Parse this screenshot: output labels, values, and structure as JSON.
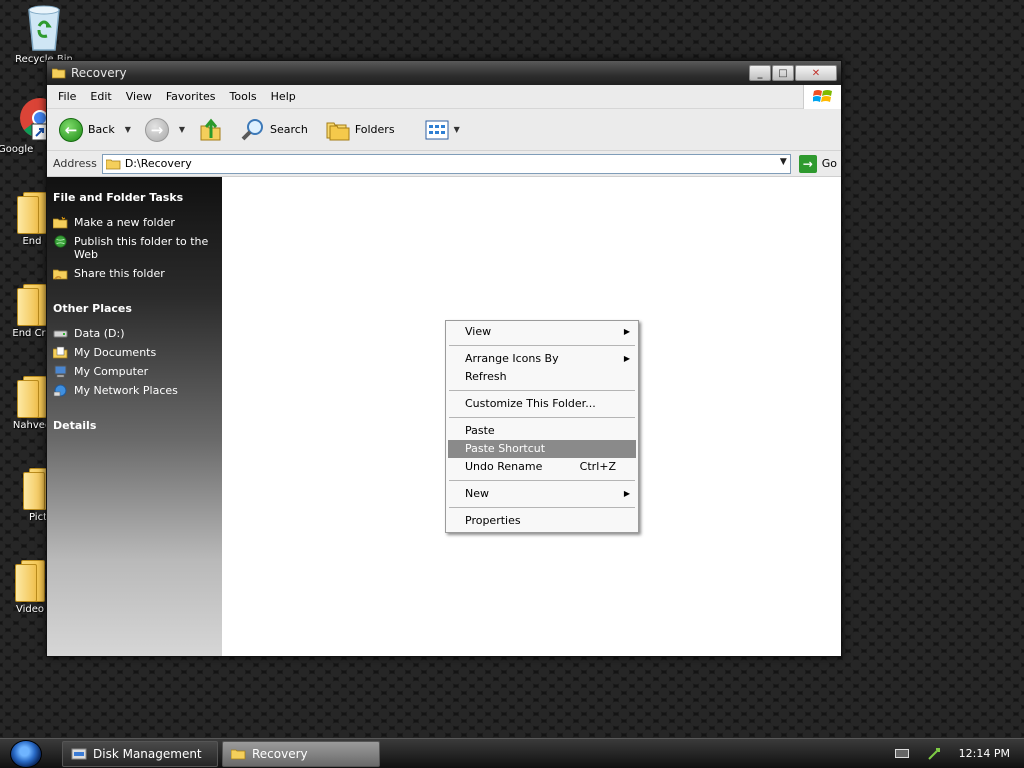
{
  "desktop": {
    "icons": [
      {
        "label": "Recycle Bin"
      },
      {
        "label": "Google"
      },
      {
        "label": "End"
      },
      {
        "label": "End Cre"
      },
      {
        "label": "Nahvee"
      },
      {
        "label": "Pict"
      },
      {
        "label": "Video"
      }
    ]
  },
  "window": {
    "title": "Recovery",
    "controls": {
      "minimize": "_",
      "maximize": "□",
      "close": "✕"
    },
    "menu": [
      "File",
      "Edit",
      "View",
      "Favorites",
      "Tools",
      "Help"
    ],
    "toolbar": {
      "back": "Back",
      "search": "Search",
      "folders": "Folders"
    },
    "address": {
      "label": "Address",
      "value": "D:\\Recovery",
      "go": "Go"
    },
    "taskpane": {
      "file_tasks": {
        "title": "File and Folder Tasks",
        "items": [
          "Make a new folder",
          "Publish this folder to the Web",
          "Share this folder"
        ]
      },
      "other_places": {
        "title": "Other Places",
        "items": [
          "Data (D:)",
          "My Documents",
          "My Computer",
          "My Network Places"
        ]
      },
      "details": {
        "title": "Details"
      }
    }
  },
  "context_menu": {
    "items": [
      {
        "label": "View",
        "submenu": true
      },
      {
        "label": "Arrange Icons By",
        "submenu": true
      },
      {
        "label": "Refresh"
      },
      {
        "label": "Customize This Folder..."
      },
      {
        "label": "Paste"
      },
      {
        "label": "Paste Shortcut",
        "highlighted": true
      },
      {
        "label": "Undo Rename",
        "shortcut": "Ctrl+Z"
      },
      {
        "label": "New",
        "submenu": true
      },
      {
        "label": "Properties"
      }
    ]
  },
  "taskbar": {
    "tasks": [
      {
        "label": "Disk Management"
      },
      {
        "label": "Recovery",
        "active": true
      }
    ],
    "clock": "12:14 PM"
  }
}
